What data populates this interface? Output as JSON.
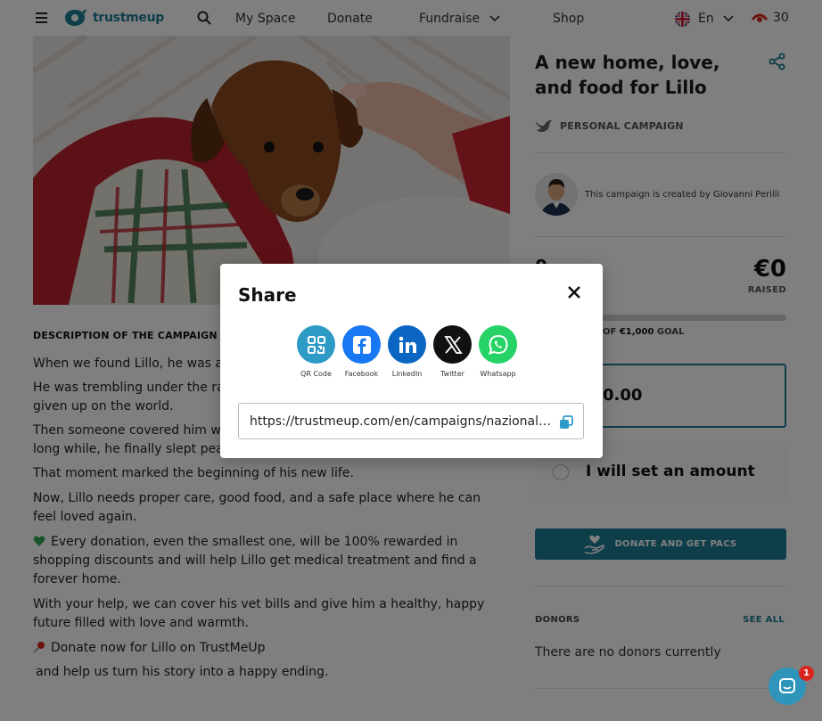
{
  "nav": {
    "logo_text": "trustmeup",
    "links": [
      "My Space",
      "Donate",
      "Fundraise",
      "Shop"
    ],
    "language": "En",
    "pacs": "30"
  },
  "hero": {
    "alt_icon": "puppy-photo"
  },
  "campaign": {
    "title": "A new home, love, and food for Lillo",
    "type": "PERSONAL CAMPAIGN",
    "creator_text": "This campaign is created by Giovanni Perilli",
    "donors_count": "0",
    "raised_amount": "€0",
    "raised_label": "RAISED",
    "progress_fraction": 0,
    "goal_prefix": "OF",
    "goal_amount": "€1,000",
    "goal_suffix": "GOAL",
    "amount_value": "0.00",
    "custom_amount_label": "I will set an amount",
    "donate_button": "DONATE AND GET PACS",
    "donors_title": "DONORS",
    "see_all": "SEE ALL",
    "no_donors": "There are no donors currently"
  },
  "description": {
    "title": "DESCRIPTION OF THE CAMPAIGN",
    "paragraphs": [
      "When we found Lillo, he was alo",
      "He was trembling under the rai",
      "given up on the world.",
      "Then someone covered him with",
      "long while, he finally slept peace",
      "That moment marked the beginning of his new life.",
      "Now, Lillo needs proper care, good food, and a safe place where he can feel loved again.",
      "Every donation, even the smallest one, will be 100% rewarded in shopping discounts and will help Lillo get medical treatment and find a forever home.",
      "With your help, we can cover his vet bills and give him a healthy, happy future filled with love and warmth.",
      "Donate now for Lillo on TrustMeUp",
      "and help us turn his story into a happy ending."
    ]
  },
  "share_modal": {
    "title": "Share",
    "options": [
      {
        "label": "QR Code",
        "icon": "qr-code-icon",
        "color": "#2e9bc7"
      },
      {
        "label": "Facebook",
        "icon": "facebook-icon",
        "color": "#1877f2"
      },
      {
        "label": "LinkedIn",
        "icon": "linkedin-icon",
        "color": "#0a66c2"
      },
      {
        "label": "Twitter",
        "icon": "x-icon",
        "color": "#111111"
      },
      {
        "label": "Whatsapp",
        "icon": "whatsapp-icon",
        "color": "#25d366"
      }
    ],
    "url": "https://trustmeup.com/en/campaigns/nazionale-italiana"
  },
  "chat": {
    "badge": "1"
  },
  "colors": {
    "accent": "#1d7d95"
  }
}
